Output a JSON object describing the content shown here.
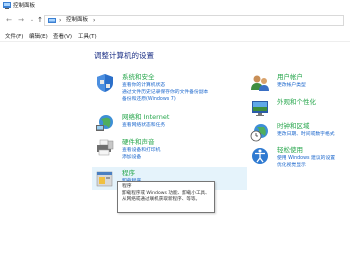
{
  "window": {
    "title": "控制面板"
  },
  "nav": {
    "back": "←",
    "forward": "→",
    "up": "↑",
    "address": "控制面板"
  },
  "menu": [
    "文件(F)",
    "编辑(E)",
    "查看(V)",
    "工具(T)"
  ],
  "heading": "调整计算机的设置",
  "categories_left": [
    {
      "title": "系统和安全",
      "icon": "shield-icon",
      "links": [
        "查看你的计算机状态",
        "通过文件历史记录保存你的文件备份副本",
        "备份和还原(Windows 7)"
      ]
    },
    {
      "title": "网络和 Internet",
      "icon": "network-icon",
      "links": [
        "查看网络状态和任务"
      ]
    },
    {
      "title": "硬件和声音",
      "icon": "printer-icon",
      "links": [
        "查看设备和打印机",
        "添加设备"
      ]
    },
    {
      "title": "程序",
      "icon": "programs-icon",
      "links": [
        "卸载程序"
      ]
    }
  ],
  "categories_right": [
    {
      "title": "用户帐户",
      "icon": "users-icon",
      "links": [
        "更改帐户类型"
      ]
    },
    {
      "title": "外观和个性化",
      "icon": "appearance-icon",
      "links": []
    },
    {
      "title": "时钟和区域",
      "icon": "clock-icon",
      "links": [
        "更改日期、时间或数字格式"
      ]
    },
    {
      "title": "轻松使用",
      "icon": "ease-of-access-icon",
      "links": [
        "使用 Windows 建议的设置",
        "优化视觉显示"
      ]
    }
  ],
  "tooltip": {
    "title": "程序",
    "body": "卸载程序或 Windows 功能、卸载小工具、从网络或通过联机获取新程序、等等。"
  }
}
